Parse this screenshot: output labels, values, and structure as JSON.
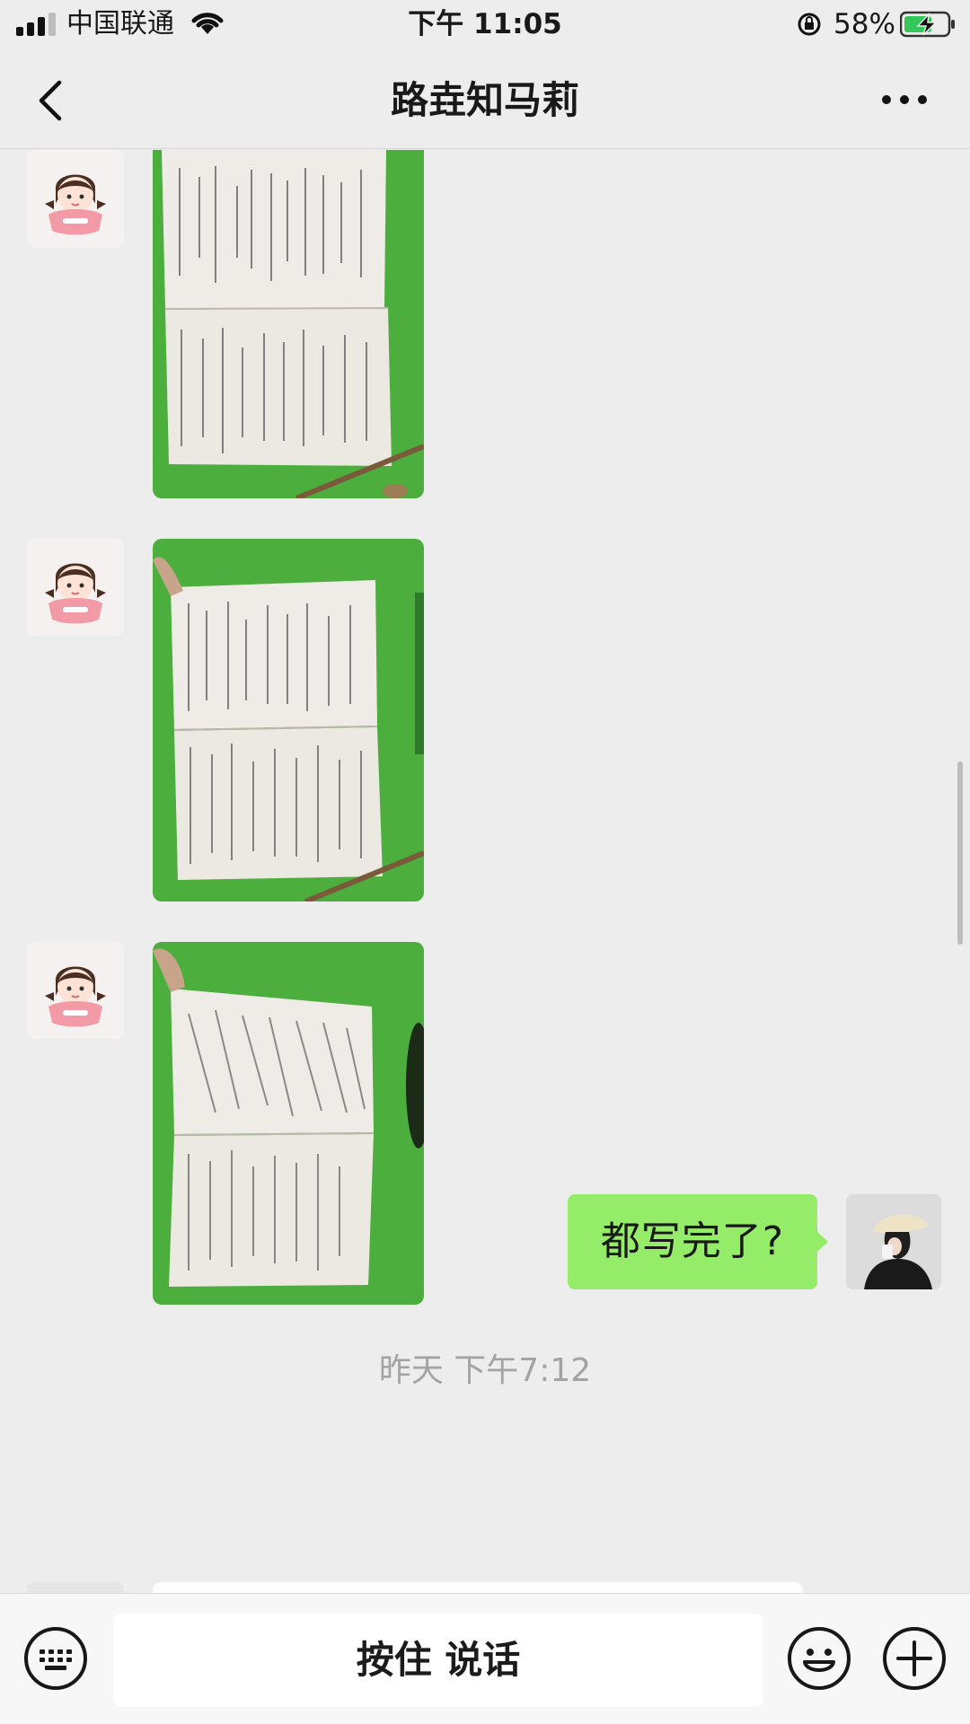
{
  "status_bar": {
    "carrier": "中国联通",
    "time": "下午 11:05",
    "battery": "58%",
    "icons": [
      "signal-icon",
      "wifi-icon",
      "orientation-lock-icon",
      "battery-charging-icon"
    ]
  },
  "nav": {
    "title": "路垚知马莉",
    "back_icon": "chevron-left-icon",
    "more_icon": "more-dots-icon"
  },
  "messages": [
    {
      "sender": "contact",
      "type": "image",
      "content": "handwritten homework photo"
    },
    {
      "sender": "contact",
      "type": "image",
      "content": "handwritten homework photo"
    },
    {
      "sender": "contact",
      "type": "image",
      "content": "handwritten homework photo"
    },
    {
      "sender": "me",
      "type": "text",
      "text": "都写完了?"
    }
  ],
  "timestamp": "昨天 下午7:12",
  "input_bar": {
    "voice_label": "按住 说话",
    "keyboard_icon": "keyboard-icon",
    "emoji_icon": "emoji-icon",
    "plus_icon": "plus-icon"
  },
  "colors": {
    "background": "#ededed",
    "my_bubble": "#95ec69",
    "timestamp_text": "#a3a3a3",
    "photo_green": "#4cae3d"
  }
}
